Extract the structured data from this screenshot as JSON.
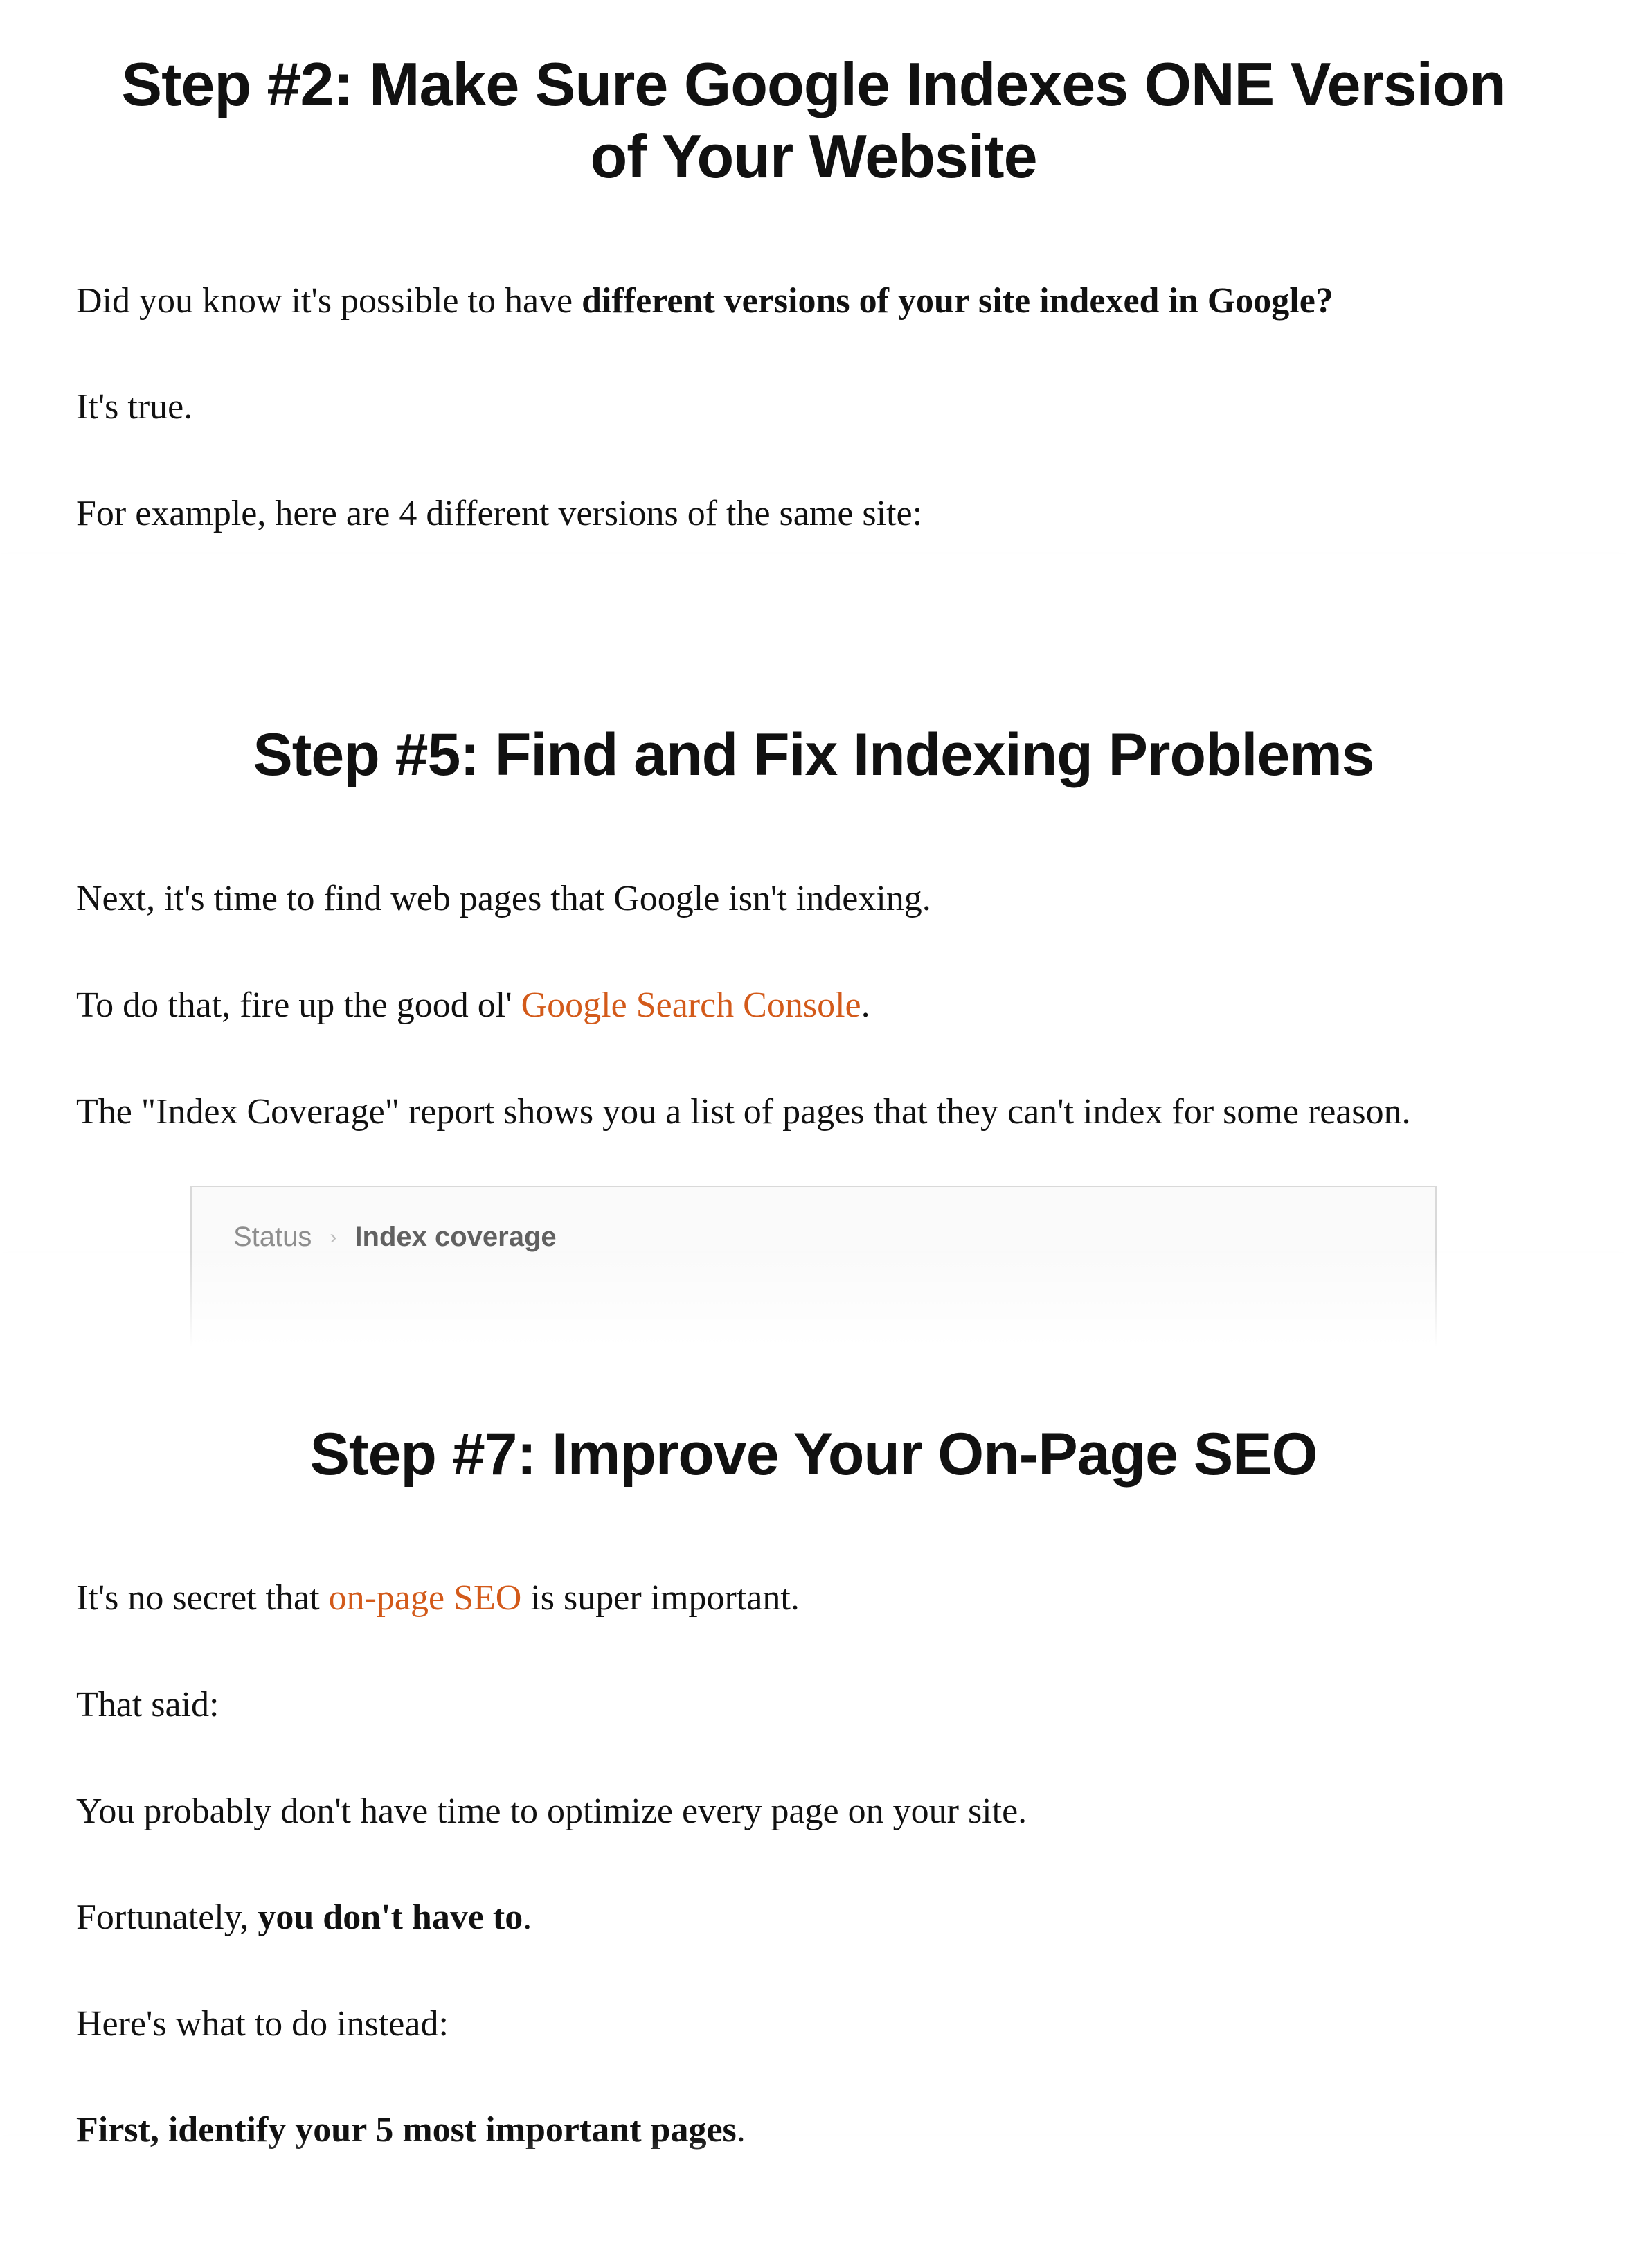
{
  "section2": {
    "heading": "Step #2: Make Sure Google Indexes ONE Version of Your Website",
    "p1_lead": "Did you know it's possible to have ",
    "p1_bold": "different versions of your site indexed in Google?",
    "p2": "It's true.",
    "p3": "For example, here are 4 different versions of the same site:"
  },
  "section5": {
    "heading": "Step #5: Find and Fix Indexing Problems",
    "p1": "Next, it's time to find web pages that Google isn't indexing.",
    "p2_lead": "To do that, fire up the good ol' ",
    "p2_link": "Google Search Console",
    "p2_tail": ".",
    "p3": "The \"Index Coverage\" report shows you a list of pages that they can't index for some reason.",
    "breadcrumb_status": "Status",
    "breadcrumb_chevron": "›",
    "breadcrumb_current": "Index coverage"
  },
  "section7": {
    "heading": "Step #7: Improve Your On-Page SEO",
    "p1_lead": "It's no secret that ",
    "p1_link": "on-page SEO",
    "p1_tail": " is super important.",
    "p2": "That said:",
    "p3": "You probably don't have time to optimize every page on your site.",
    "p4_lead": "Fortunately, ",
    "p4_bold": "you don't have to",
    "p4_tail": ".",
    "p5": "Here's what to do instead:",
    "p6_bold": "First, identify your 5 most important pages",
    "p6_tail": "."
  }
}
